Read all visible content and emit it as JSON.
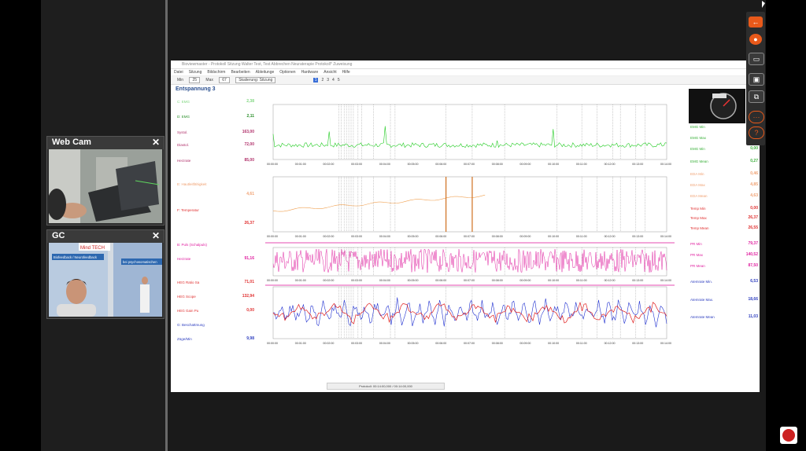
{
  "webcam": {
    "title": "Web Cam",
    "close": "✕"
  },
  "gc": {
    "title": "GC",
    "close": "✕",
    "banner_brand": "Mind TECH",
    "banner_line1": "Biofeedback / Neurofeedback",
    "banner_line2": "bei psychosomatischen"
  },
  "app": {
    "title": "Bioviewmaster - Protokoll Sitzung Walter Test, Test Abbrechen Neuraterapie Protokoll* Zuweisung",
    "menu": [
      "Datei",
      "Sitzung",
      "Bildschirm",
      "Bearbeiten",
      "Ableitunge",
      "Optionen",
      "Hardware",
      "Ansicht",
      "Hilfe"
    ],
    "toolbar": {
      "min_label": "Min",
      "min_value": "25",
      "max_label": "Max",
      "max_value": "67",
      "mode": "Skalierung: Sitzung",
      "pages": [
        "1",
        "2",
        "3",
        "4",
        "5"
      ]
    },
    "section_title": "Entspannung 3",
    "left_labels": [
      {
        "label": "C: EMG",
        "value": "2,38",
        "color": "#7fd67f"
      },
      {
        "label": "D: EMG",
        "value": "2,11",
        "color": "#2a8f2a"
      },
      {
        "label": "Systol.",
        "value": "163,00",
        "color": "#b0306a"
      },
      {
        "label": "Diastol.",
        "value": "72,00",
        "color": "#b0306a"
      },
      {
        "label": "Herzrate",
        "value": "85,00",
        "color": "#b0306a"
      },
      {
        "label": "E: Hautleitfähigkeit",
        "value": "",
        "color": "#f0a070"
      },
      {
        "label": "",
        "value": "4,61",
        "color": "#f0a070"
      },
      {
        "label": "F: Temperatur",
        "value": "",
        "color": "#e03030"
      },
      {
        "label": "",
        "value": "26,37",
        "color": "#e03030"
      },
      {
        "label": "B: Puls (Schalpuls)",
        "value": "",
        "color": "#e020a0"
      },
      {
        "label": "Herzrate",
        "value": "91,16",
        "color": "#e020a0"
      },
      {
        "label": "HEG Ratio Sa",
        "value": "71,01",
        "color": "#e03030"
      },
      {
        "label": "HEG Scope",
        "value": "132,94",
        "color": "#e03030"
      },
      {
        "label": "HEG Gain Pu",
        "value": "0,00",
        "color": "#e03030"
      },
      {
        "label": "G: Beschattmung",
        "value": "",
        "color": "#3040c0"
      },
      {
        "label": "Züge/Min",
        "value": "9,98",
        "color": "#3040c0"
      }
    ],
    "right_labels": [
      {
        "label": "EMG Min",
        "value": "",
        "color": "#3ab03a"
      },
      {
        "label": "EMG Max",
        "value": "",
        "color": "#3ab03a"
      },
      {
        "label": "EMG Min",
        "value": "0,00",
        "color": "#3ab03a"
      },
      {
        "label": "EMG Mean",
        "value": "0,27",
        "color": "#3ab03a"
      },
      {
        "label": "EDA Min",
        "value": "0,46",
        "color": "#f0a070"
      },
      {
        "label": "EDA Max",
        "value": "4,85",
        "color": "#f0a070"
      },
      {
        "label": "EDA Mean",
        "value": "4,63",
        "color": "#f0a070"
      },
      {
        "label": "Temp Min",
        "value": "0,00",
        "color": "#e03030"
      },
      {
        "label": "Temp Max",
        "value": "26,37",
        "color": "#e03030"
      },
      {
        "label": "Temp Mean",
        "value": "26,55",
        "color": "#e03030"
      },
      {
        "label": "PR Min",
        "value": "79,37",
        "color": "#e020a0"
      },
      {
        "label": "PR Max",
        "value": "140,52",
        "color": "#e020a0"
      },
      {
        "label": "PR Mean",
        "value": "87,50",
        "color": "#e020a0"
      },
      {
        "label": "Atemrate Min.",
        "value": "6,53",
        "color": "#3040c0"
      },
      {
        "label": "Atemrate Max.",
        "value": "18,66",
        "color": "#3040c0"
      },
      {
        "label": "Atemrate Mean",
        "value": "11,03",
        "color": "#3040c0"
      }
    ],
    "time_ticks": [
      "00:00:00",
      "00:01:00",
      "00:02:00",
      "00:03:00",
      "00:04:00",
      "00:05:00",
      "00:06:00",
      "00:07:00",
      "00:08:00",
      "00:09:00",
      "00:10:00",
      "00:11:00",
      "00:12:00",
      "00:13:00",
      "00:14:00"
    ],
    "status": "Protokoll: 00:14:00,000 / 00:14:00,000"
  },
  "toolbar_icons": [
    "back-arrow-icon",
    "microphone-icon",
    "camera-icon",
    "screen-share-icon",
    "copy-icon",
    "more-icon",
    "chat-icon"
  ]
}
